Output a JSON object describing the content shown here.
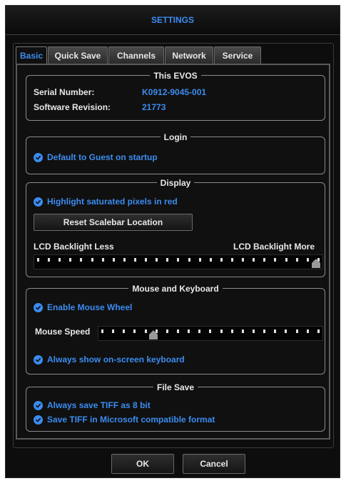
{
  "window": {
    "title": "SETTINGS"
  },
  "tabs": [
    {
      "label": "Basic",
      "active": true
    },
    {
      "label": "Quick Save",
      "active": false
    },
    {
      "label": "Channels",
      "active": false
    },
    {
      "label": "Network",
      "active": false
    },
    {
      "label": "Service",
      "active": false
    }
  ],
  "this_evos": {
    "title": "This EVOS",
    "serial_label": "Serial Number:",
    "serial_value": "K0912-9045-001",
    "software_label": "Software Revision:",
    "software_value": "21773"
  },
  "login": {
    "title": "Login",
    "default_guest": {
      "label": "Default to Guest on startup",
      "checked": true
    }
  },
  "display": {
    "title": "Display",
    "highlight": {
      "label": "Highlight saturated pixels in red",
      "checked": true
    },
    "reset_button": "Reset Scalebar Location",
    "backlight_less": "LCD Backlight Less",
    "backlight_more": "LCD Backlight More",
    "backlight_level": 1.0
  },
  "mouse": {
    "title": "Mouse and Keyboard",
    "wheel": {
      "label": "Enable Mouse Wheel",
      "checked": true
    },
    "speed_label": "Mouse Speed",
    "speed_level": 0.23,
    "keyboard": {
      "label": "Always show on-screen keyboard",
      "checked": true
    }
  },
  "file_save": {
    "title": "File Save",
    "tiff8": {
      "label": "Always save TIFF as 8 bit",
      "checked": true
    },
    "tiffms": {
      "label": "Save TIFF in Microsoft compatible format",
      "checked": true
    }
  },
  "footer": {
    "ok": "OK",
    "cancel": "Cancel"
  },
  "colors": {
    "accent": "#3b8cf0",
    "background": "#0d0d0d",
    "text": "#e8e8e8"
  },
  "icons": {
    "check": "check-circle-icon",
    "thumb": "slider-thumb-icon"
  }
}
